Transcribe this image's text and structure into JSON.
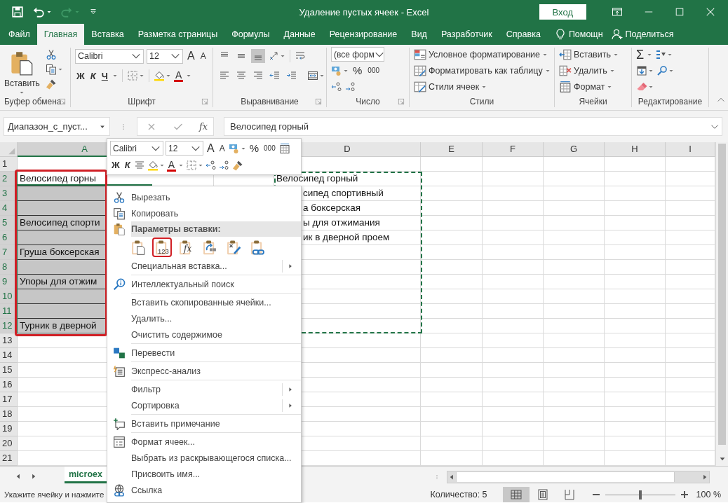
{
  "title_bar": {
    "title": "Удаление пустых ячеек  -  Excel",
    "sign_in": "Вход",
    "quick_access": [
      {
        "kind": "save",
        "disabled": false
      },
      {
        "kind": "undo",
        "disabled": false
      },
      {
        "kind": "redo",
        "disabled": true
      },
      {
        "kind": "customize",
        "disabled": false
      }
    ]
  },
  "tabs": [
    {
      "label": "Файл",
      "selected": false
    },
    {
      "label": "Главная",
      "selected": true
    },
    {
      "label": "Вставка",
      "selected": false
    },
    {
      "label": "Разметка страницы",
      "selected": false
    },
    {
      "label": "Формулы",
      "selected": false
    },
    {
      "label": "Данные",
      "selected": false
    },
    {
      "label": "Рецензирование",
      "selected": false
    },
    {
      "label": "Вид",
      "selected": false
    },
    {
      "label": "Разработчик",
      "selected": false
    },
    {
      "label": "Справка",
      "selected": false
    }
  ],
  "tell_me": "Помощн",
  "share": "Поделиться",
  "ribbon": {
    "clipboard": {
      "paste": "Вставить",
      "label": "Буфер обмена"
    },
    "font": {
      "font": "Calibri",
      "size": "12",
      "grow": "A",
      "shrink": "A",
      "bold": "Ж",
      "italic": "К",
      "underline": "Ч",
      "letter_a": "A",
      "label": "Шрифт"
    },
    "alignment": {
      "vertical": [
        {
          "selected": false
        },
        {
          "selected": false
        },
        {
          "selected": true
        }
      ],
      "label": "Выравнивание"
    },
    "number": {
      "format": "(все форм",
      "percent": "%",
      "thousands": "000",
      "label": "Число"
    },
    "styles": {
      "items": [
        {
          "label": "Условное форматирование"
        },
        {
          "label": "Форматировать как таблицу"
        },
        {
          "label": "Стили ячеек"
        }
      ],
      "label": "Стили"
    },
    "cells": {
      "items": [
        {
          "label": "Вставить"
        },
        {
          "label": "Удалить"
        },
        {
          "label": "Формат"
        }
      ],
      "label": "Ячейки"
    },
    "editing": {
      "sum": "Σ",
      "label": "Редактирование"
    }
  },
  "formula_bar": {
    "name_box": "Диапазон_с_пуст...",
    "fx": "fx",
    "value": "Велосипед горный"
  },
  "sheet": {
    "columns": [
      {
        "label": "A",
        "selected": true
      },
      {
        "label": "D",
        "selected": false
      },
      {
        "label": "E",
        "selected": false
      },
      {
        "label": "F",
        "selected": false
      },
      {
        "label": "G",
        "selected": false
      },
      {
        "label": "H",
        "selected": false
      },
      {
        "label": "I",
        "selected": false
      }
    ],
    "rows": [
      {
        "header": "1",
        "selected": false
      },
      {
        "header": "2",
        "selected": true,
        "a": {
          "text": "Велосипед горны",
          "selected": true,
          "active": true
        },
        "d": {
          "text": "Велосипед горный",
          "cut_left": false
        }
      },
      {
        "header": "3",
        "selected": true,
        "a": {
          "selected": true,
          "active": false
        },
        "d": {
          "text": "сипед спортивный",
          "cut_left": true
        }
      },
      {
        "header": "4",
        "selected": true,
        "a": {
          "selected": true,
          "active": false
        },
        "d": {
          "text": "а боксерская",
          "cut_left": true
        }
      },
      {
        "header": "5",
        "selected": true,
        "a": {
          "text": "Велосипед спорти",
          "selected": true,
          "active": false
        },
        "d": {
          "text": "ы для отжимания",
          "cut_left": true
        }
      },
      {
        "header": "6",
        "selected": true,
        "a": {
          "selected": true,
          "active": false
        },
        "d": {
          "text": "ик в дверной проем",
          "cut_left": true
        }
      },
      {
        "header": "7",
        "selected": true,
        "a": {
          "text": "Груша боксерская",
          "selected": true,
          "active": false
        }
      },
      {
        "header": "8",
        "selected": true,
        "a": {
          "selected": true,
          "active": false
        }
      },
      {
        "header": "9",
        "selected": true,
        "a": {
          "text": "Упоры для отжим",
          "selected": true,
          "active": false
        }
      },
      {
        "header": "10",
        "selected": true,
        "a": {
          "selected": true,
          "active": false
        }
      },
      {
        "header": "11",
        "selected": true,
        "a": {
          "selected": true,
          "active": false
        }
      },
      {
        "header": "12",
        "selected": true,
        "a": {
          "text": "Турник в дверной",
          "selected": true,
          "active": false
        }
      },
      {
        "header": "13",
        "selected": false
      },
      {
        "header": "14",
        "selected": false
      },
      {
        "header": "15",
        "selected": false
      },
      {
        "header": "16",
        "selected": false
      },
      {
        "header": "17",
        "selected": false
      },
      {
        "header": "18",
        "selected": false
      },
      {
        "header": "19",
        "selected": false
      },
      {
        "header": "20",
        "selected": false
      },
      {
        "header": "21",
        "selected": false
      }
    ]
  },
  "mini_toolbar": {
    "font": "Calibri",
    "size": "12",
    "grow": "A",
    "shrink": "A",
    "percent": "%",
    "thousands": "000",
    "bold": "Ж",
    "italic": "К",
    "letter_a": "A"
  },
  "context_menu": {
    "items": [
      {
        "kind": "item",
        "label": "Вырезать"
      },
      {
        "kind": "item",
        "label": "Копировать"
      },
      {
        "kind": "header",
        "label": "Параметры вставки:"
      },
      {
        "kind": "paste_options",
        "options": [
          {
            "selected": false
          },
          {
            "label": "123",
            "selected": true
          },
          {
            "label": "fx",
            "selected": false
          },
          {
            "selected": false
          },
          {
            "selected": false
          },
          {
            "selected": false
          }
        ]
      },
      {
        "kind": "item",
        "label": "Специальная вставка...",
        "submenu": true
      },
      {
        "kind": "separator"
      },
      {
        "kind": "item",
        "label": "Интеллектуальный поиск"
      },
      {
        "kind": "separator"
      },
      {
        "kind": "item",
        "label": "Вставить скопированные ячейки..."
      },
      {
        "kind": "item",
        "label": "Удалить..."
      },
      {
        "kind": "item",
        "label": "Очистить содержимое"
      },
      {
        "kind": "separator"
      },
      {
        "kind": "item",
        "label": "Перевести"
      },
      {
        "kind": "separator"
      },
      {
        "kind": "item",
        "label": "Экспресс-анализ"
      },
      {
        "kind": "separator"
      },
      {
        "kind": "item",
        "label": "Фильтр",
        "submenu": true
      },
      {
        "kind": "item",
        "label": "Сортировка",
        "submenu": true
      },
      {
        "kind": "separator"
      },
      {
        "kind": "item",
        "label": "Вставить примечание"
      },
      {
        "kind": "separator"
      },
      {
        "kind": "item",
        "label": "Формат ячеек..."
      },
      {
        "kind": "item",
        "label": "Выбрать из раскрывающегося списка..."
      },
      {
        "kind": "item",
        "label": "Присвоить имя..."
      },
      {
        "kind": "item",
        "label": "Ссылка"
      }
    ]
  },
  "sheet_tabs": [
    {
      "label": "microex",
      "selected": true
    }
  ],
  "status_bar": {
    "message": "Укажите ячейку и нажмите",
    "count": "Количество: 5",
    "views": [
      {
        "kind": "normal",
        "selected": true
      },
      {
        "kind": "page_layout",
        "selected": false
      },
      {
        "kind": "page_break",
        "selected": false
      }
    ],
    "zoom": {
      "level": 0.5,
      "reading": "100 %"
    }
  }
}
